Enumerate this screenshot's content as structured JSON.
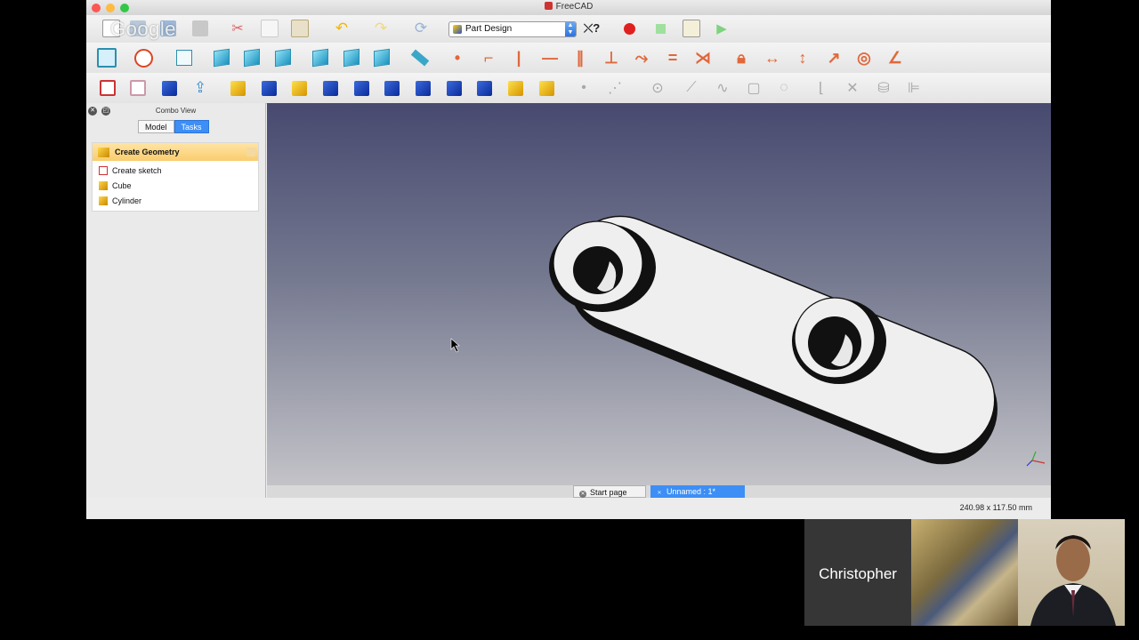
{
  "window": {
    "title": "FreeCAD"
  },
  "overlay": {
    "watermark": "Google"
  },
  "toolbar": {
    "workbench": "Part Design"
  },
  "combo": {
    "title": "Combo View",
    "tabs": [
      {
        "label": "Model"
      },
      {
        "label": "Tasks",
        "active": true
      }
    ],
    "task_header": "Create Geometry",
    "task_items": [
      {
        "label": "Create sketch",
        "icon": "sketch-icon"
      },
      {
        "label": "Cube",
        "icon": "cube-icon"
      },
      {
        "label": "Cylinder",
        "icon": "cylinder-icon"
      }
    ]
  },
  "doc_tabs": [
    {
      "label": "Start page"
    },
    {
      "label": "Unnamed : 1*",
      "active": true
    }
  ],
  "status": {
    "dimensions": "240.98 x 117.50 mm"
  },
  "participants": {
    "name": "Christopher"
  },
  "colors": {
    "accent": "#3d8ef5",
    "sketcher_red": "#e0683c",
    "viewport_top": "#47496f",
    "viewport_bottom": "#c3c3c8"
  }
}
